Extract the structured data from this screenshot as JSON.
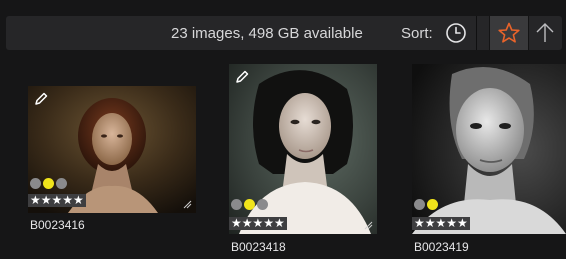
{
  "toolbar": {
    "status": "23 images, 498 GB available",
    "sort_label": "Sort:",
    "sort_buttons": [
      {
        "icon": "clock-icon",
        "active": false
      },
      {
        "icon": "star-icon",
        "active": true,
        "color": "#e8632a"
      },
      {
        "icon": "arrow-up-icon",
        "active": false
      }
    ]
  },
  "thumbnails": [
    {
      "name": "B0023416",
      "stars": "★★★★★",
      "labels": [
        "gray",
        "yellow",
        "gray"
      ],
      "selected_label_color": "#f1e41b",
      "has_edit_icon": true
    },
    {
      "name": "B0023418",
      "stars": "★★★★★",
      "labels": [
        "gray",
        "yellow",
        "gray"
      ],
      "selected_label_color": "#f1e41b",
      "has_edit_icon": true
    },
    {
      "name": "B0023419",
      "stars": "★★★★★",
      "labels": [
        "gray",
        "yellow"
      ],
      "selected_label_color": "#f1e41b",
      "has_edit_icon": false
    }
  ],
  "colors": {
    "background": "#161617",
    "toolbar": "#262628",
    "accent_star": "#e8632a"
  }
}
